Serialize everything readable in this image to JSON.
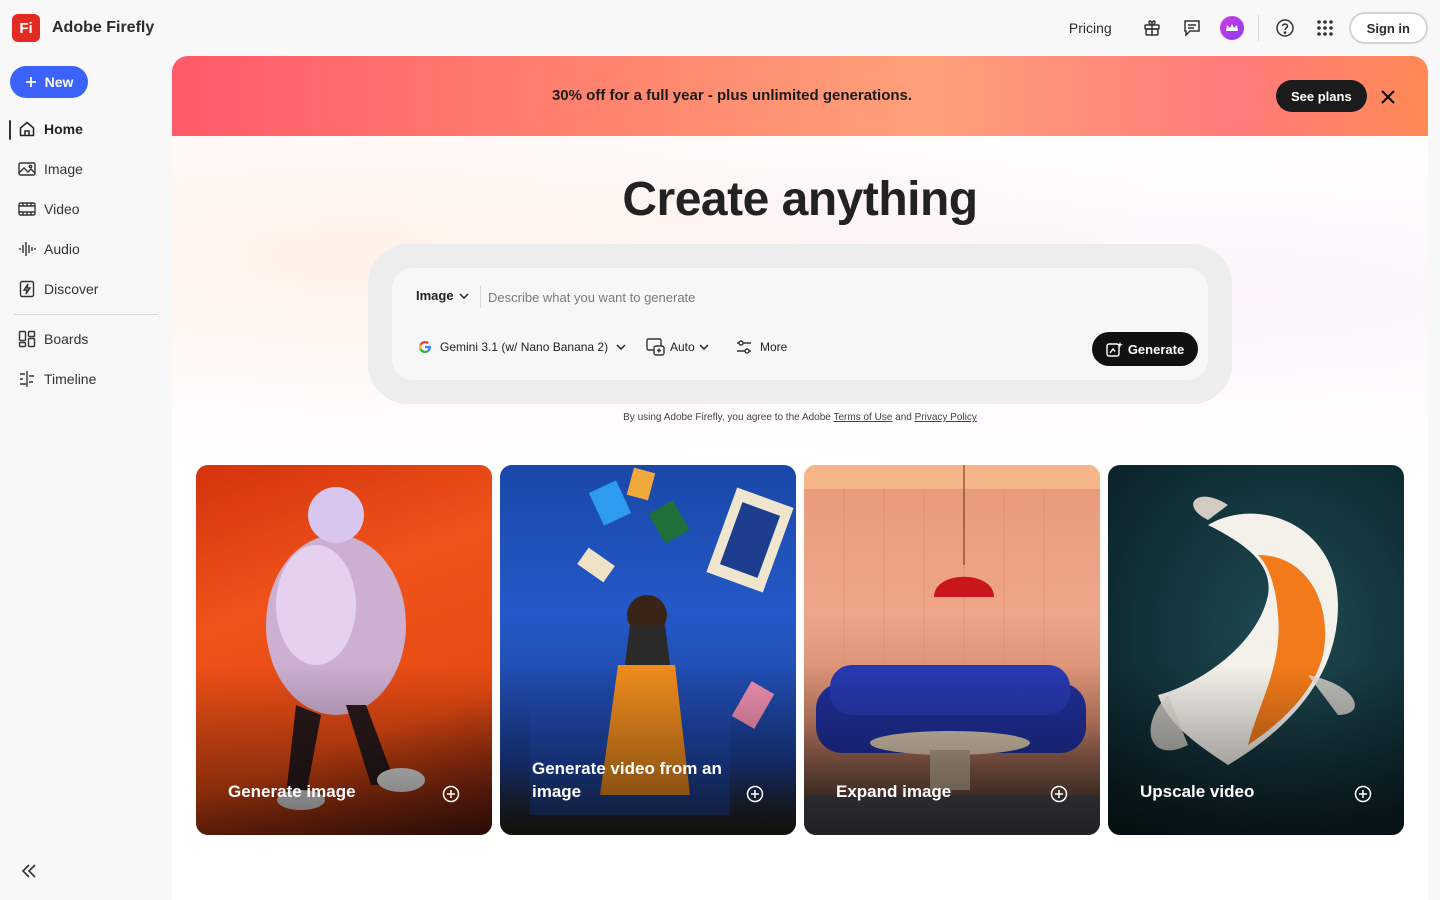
{
  "app": {
    "logo_text": "Fi",
    "name": "Adobe Firefly"
  },
  "header": {
    "pricing": "Pricing",
    "sign_in": "Sign in",
    "icons": [
      "gift-icon",
      "feedback-icon",
      "plan-crown-icon",
      "help-icon",
      "apps-grid-icon"
    ]
  },
  "sidebar": {
    "new_label": "New",
    "items": [
      {
        "label": "Home",
        "icon": "home-icon",
        "active": true
      },
      {
        "label": "Image",
        "icon": "image-icon"
      },
      {
        "label": "Video",
        "icon": "video-icon"
      },
      {
        "label": "Audio",
        "icon": "audio-icon"
      },
      {
        "label": "Discover",
        "icon": "discover-icon"
      },
      {
        "label": "Boards",
        "icon": "boards-icon"
      },
      {
        "label": "Timeline",
        "icon": "timeline-icon"
      }
    ]
  },
  "banner": {
    "text": "30% off for a full year - plus unlimited generations.",
    "cta": "See plans"
  },
  "hero": {
    "title": "Create anything"
  },
  "prompt": {
    "type": "Image",
    "placeholder": "Describe what you want to generate",
    "model": "Gemini 3.1 (w/ Nano Banana 2)",
    "ratio": "Auto",
    "more": "More",
    "generate": "Generate"
  },
  "legal": {
    "prefix": "By using Adobe Firefly, you agree to the Adobe",
    "terms": "Terms of Use",
    "and": "and",
    "privacy": "Privacy Policy"
  },
  "cards": [
    {
      "label": "Generate image"
    },
    {
      "label": "Generate video from an image"
    },
    {
      "label": "Expand image"
    },
    {
      "label": "Upscale video"
    }
  ],
  "colors": {
    "accent": "#3b63fb",
    "logo": "#e32b24",
    "dark_button": "#111111"
  }
}
